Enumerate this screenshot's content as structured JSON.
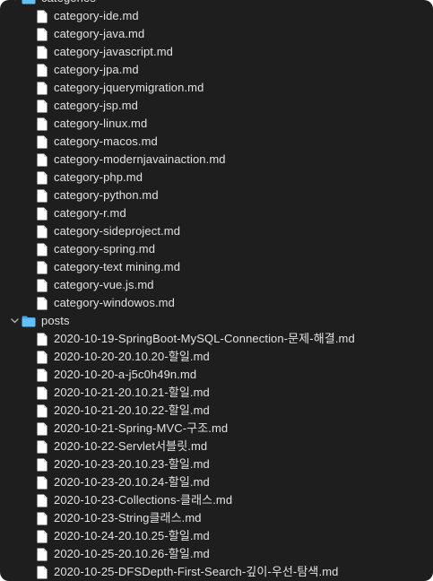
{
  "tree": [
    {
      "name": "categories",
      "icon": "folder-icon",
      "expanded": true,
      "files": [
        "category-ide.md",
        "category-java.md",
        "category-javascript.md",
        "category-jpa.md",
        "category-jquerymigration.md",
        "category-jsp.md",
        "category-linux.md",
        "category-macos.md",
        "category-modernjavainaction.md",
        "category-php.md",
        "category-python.md",
        "category-r.md",
        "category-sideproject.md",
        "category-spring.md",
        "category-text mining.md",
        "category-vue.js.md",
        "category-windowos.md"
      ]
    },
    {
      "name": "posts",
      "icon": "folder-icon",
      "expanded": true,
      "files": [
        "2020-10-19-SpringBoot-MySQL-Connection-문제-해결.md",
        "2020-10-20-20.10.20-할일.md",
        "2020-10-20-a-j5c0h49n.md",
        "2020-10-21-20.10.21-할일.md",
        "2020-10-21-20.10.22-할일.md",
        "2020-10-21-Spring-MVC-구조.md",
        "2020-10-22-Servlet서블릿.md",
        "2020-10-23-20.10.23-할일.md",
        "2020-10-23-20.10.24-할일.md",
        "2020-10-23-Collections-클래스.md",
        "2020-10-23-String클래스.md",
        "2020-10-24-20.10.25-할일.md",
        "2020-10-25-20.10.26-할일.md",
        "2020-10-25-DFSDepth-First-Search-깊이-우선-탐색.md"
      ]
    }
  ],
  "colors": {
    "background": "#1e1e1e",
    "text": "#e2e2e2",
    "folder": "#5ab8f0",
    "file": "#ffffff"
  }
}
